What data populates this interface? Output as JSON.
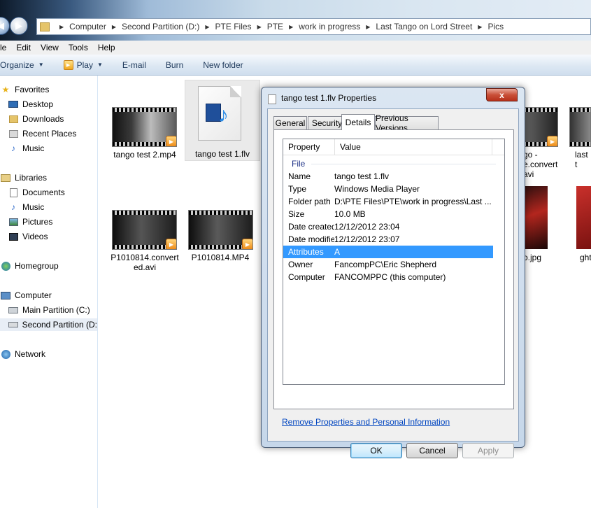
{
  "address": {
    "crumbs": [
      "Computer",
      "Second Partition (D:)",
      "PTE Files",
      "PTE",
      "work in progress",
      "Last Tango on Lord Street",
      "Pics"
    ]
  },
  "menu": [
    "le",
    "Edit",
    "View",
    "Tools",
    "Help"
  ],
  "toolbar": {
    "organize": "Organize",
    "play": "Play",
    "email": "E-mail",
    "burn": "Burn",
    "new_folder": "New folder"
  },
  "navpane": {
    "favorites": "Favorites",
    "desktop": "Desktop",
    "downloads": "Downloads",
    "recent": "Recent Places",
    "music": "Music",
    "libraries": "Libraries",
    "documents": "Documents",
    "lib_music": "Music",
    "pictures": "Pictures",
    "videos": "Videos",
    "homegroup": "Homegroup",
    "computer": "Computer",
    "main_partition": "Main Partition (C:)",
    "second_partition": "Second Partition (D:",
    "network": "Network"
  },
  "files": {
    "f1": "tango test 2.mp4",
    "f2": "tango test 1.flv",
    "f3_line1": "P1010814.convert",
    "f3_line2": "ed.avi",
    "f4": "P1010814.MP4",
    "r1_line1": "go -",
    "r1_line2": "e.convert",
    "r1_line3": "avi",
    "r2": "last t",
    "r3": "o.jpg",
    "r4": "ght"
  },
  "dialog": {
    "title": "tango test 1.flv Properties",
    "close": "x",
    "tabs": {
      "general": "General",
      "security": "Security",
      "details": "Details",
      "previous": "Previous Versions"
    },
    "header_property": "Property",
    "header_value": "Value",
    "group": "File",
    "rows": {
      "name": {
        "label": "Name",
        "value": "tango test 1.flv"
      },
      "type": {
        "label": "Type",
        "value": "Windows Media Player"
      },
      "path": {
        "label": "Folder path",
        "value": "D:\\PTE Files\\PTE\\work in progress\\Last ..."
      },
      "size": {
        "label": "Size",
        "value": "10.0 MB"
      },
      "created": {
        "label": "Date created",
        "value": "12/12/2012 23:04"
      },
      "modified": {
        "label": "Date modified",
        "value": "12/12/2012 23:07"
      },
      "attrs": {
        "label": "Attributes",
        "value": "A"
      },
      "owner": {
        "label": "Owner",
        "value": "FancompPC\\Eric Shepherd"
      },
      "computer": {
        "label": "Computer",
        "value": "FANCOMPPC (this computer)"
      }
    },
    "remove_link": "Remove Properties and Personal Information",
    "ok": "OK",
    "cancel": "Cancel",
    "apply": "Apply"
  },
  "colors": {
    "selection": "#3399ff",
    "link": "#0045c0",
    "group_label": "#1e3287"
  }
}
